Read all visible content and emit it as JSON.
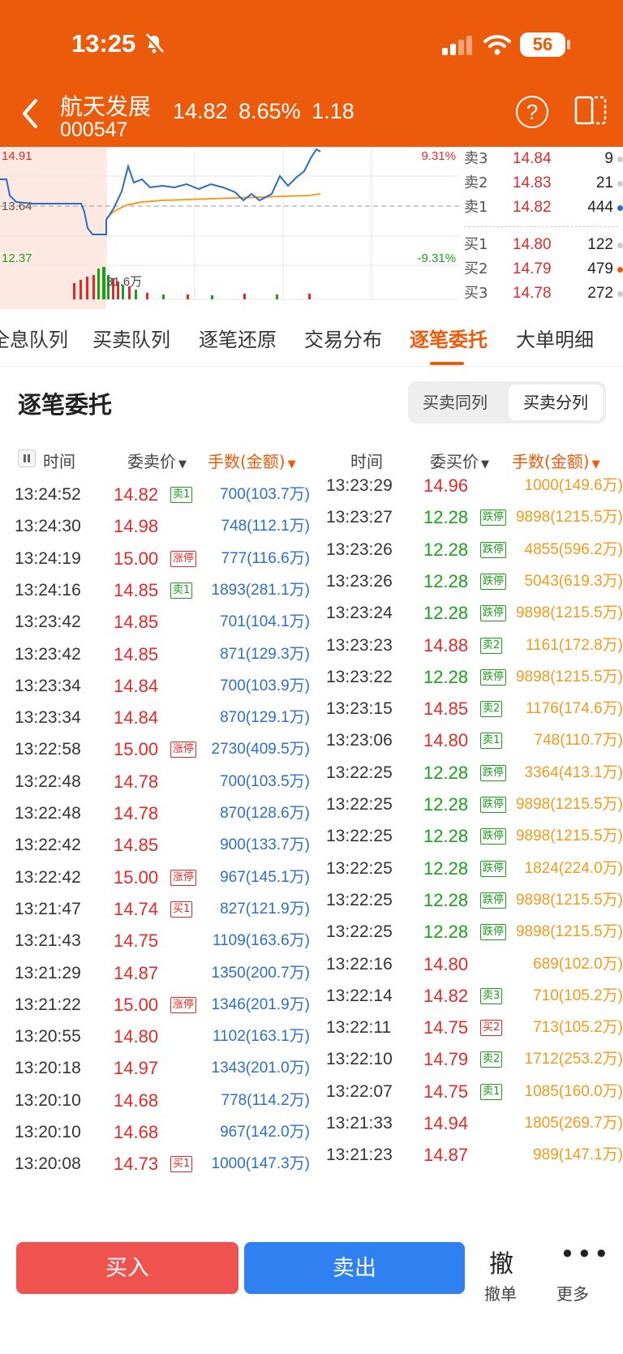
{
  "status_bar": {
    "time": "13:25",
    "battery": "56"
  },
  "header": {
    "name": "航天发展",
    "code": "000547",
    "price": "14.82",
    "change_pct": "8.65%",
    "change": "1.18"
  },
  "chart": {
    "price_high": "14.91",
    "price_pre": "13.64",
    "price_low": "12.37",
    "pct_high": "9.31%",
    "pct_low": "-9.31%",
    "volume_label": "31.6万"
  },
  "orderbook": {
    "asks": [
      {
        "label": "卖3",
        "price": "14.84",
        "volume": "9"
      },
      {
        "label": "卖2",
        "price": "14.83",
        "volume": "21"
      },
      {
        "label": "卖1",
        "price": "14.82",
        "volume": "444"
      }
    ],
    "bids": [
      {
        "label": "买1",
        "price": "14.80",
        "volume": "122"
      },
      {
        "label": "买2",
        "price": "14.79",
        "volume": "479"
      },
      {
        "label": "买3",
        "price": "14.78",
        "volume": "272"
      }
    ]
  },
  "tabs": [
    "全息队列",
    "买卖队列",
    "逐笔还原",
    "交易分布",
    "逐笔委托",
    "大单明细"
  ],
  "section": {
    "title": "逐笔委托",
    "seg_same": "买卖同列",
    "seg_split": "买卖分列"
  },
  "columns": {
    "sell_time": "时间",
    "sell_price": "委卖价",
    "sell_amount": "手数(金额)",
    "buy_time": "时间",
    "buy_price": "委买价",
    "buy_amount": "手数(金额)"
  },
  "sell_orders": [
    {
      "time": "13:24:52",
      "price": "14.82",
      "tag": "卖1",
      "amount": "700(103.7万)"
    },
    {
      "time": "13:24:30",
      "price": "14.98",
      "tag": "",
      "amount": "748(112.1万)"
    },
    {
      "time": "13:24:19",
      "price": "15.00",
      "tag": "涨停",
      "amount": "777(116.6万)"
    },
    {
      "time": "13:24:16",
      "price": "14.85",
      "tag": "卖1",
      "amount": "1893(281.1万)"
    },
    {
      "time": "13:23:42",
      "price": "14.85",
      "tag": "",
      "amount": "701(104.1万)"
    },
    {
      "time": "13:23:42",
      "price": "14.85",
      "tag": "",
      "amount": "871(129.3万)"
    },
    {
      "time": "13:23:34",
      "price": "14.84",
      "tag": "",
      "amount": "700(103.9万)"
    },
    {
      "time": "13:23:34",
      "price": "14.84",
      "tag": "",
      "amount": "870(129.1万)"
    },
    {
      "time": "13:22:58",
      "price": "15.00",
      "tag": "涨停",
      "amount": "2730(409.5万)"
    },
    {
      "time": "13:22:48",
      "price": "14.78",
      "tag": "",
      "amount": "700(103.5万)"
    },
    {
      "time": "13:22:48",
      "price": "14.78",
      "tag": "",
      "amount": "870(128.6万)"
    },
    {
      "time": "13:22:42",
      "price": "14.85",
      "tag": "",
      "amount": "900(133.7万)"
    },
    {
      "time": "13:22:42",
      "price": "15.00",
      "tag": "涨停",
      "amount": "967(145.1万)"
    },
    {
      "time": "13:21:47",
      "price": "14.74",
      "tag": "买1",
      "amount": "827(121.9万)"
    },
    {
      "time": "13:21:43",
      "price": "14.75",
      "tag": "",
      "amount": "1109(163.6万)"
    },
    {
      "time": "13:21:29",
      "price": "14.87",
      "tag": "",
      "amount": "1350(200.7万)"
    },
    {
      "time": "13:21:22",
      "price": "15.00",
      "tag": "涨停",
      "amount": "1346(201.9万)"
    },
    {
      "time": "13:20:55",
      "price": "14.80",
      "tag": "",
      "amount": "1102(163.1万)"
    },
    {
      "time": "13:20:18",
      "price": "14.97",
      "tag": "",
      "amount": "1343(201.0万)"
    },
    {
      "time": "13:20:10",
      "price": "14.68",
      "tag": "",
      "amount": "778(114.2万)"
    },
    {
      "time": "13:20:10",
      "price": "14.68",
      "tag": "",
      "amount": "967(142.0万)"
    },
    {
      "time": "13:20:08",
      "price": "14.73",
      "tag": "买1",
      "amount": "1000(147.3万)"
    }
  ],
  "buy_orders": [
    {
      "time": "13:23:29",
      "price": "14.96",
      "tag": "",
      "amount": "1000(149.6万)"
    },
    {
      "time": "13:23:27",
      "price": "12.28",
      "tag": "跌停",
      "amount": "9898(1215.5万)"
    },
    {
      "time": "13:23:26",
      "price": "12.28",
      "tag": "跌停",
      "amount": "4855(596.2万)"
    },
    {
      "time": "13:23:26",
      "price": "12.28",
      "tag": "跌停",
      "amount": "5043(619.3万)"
    },
    {
      "time": "13:23:24",
      "price": "12.28",
      "tag": "跌停",
      "amount": "9898(1215.5万)"
    },
    {
      "time": "13:23:23",
      "price": "14.88",
      "tag": "卖2",
      "amount": "1161(172.8万)"
    },
    {
      "time": "13:23:22",
      "price": "12.28",
      "tag": "跌停",
      "amount": "9898(1215.5万)"
    },
    {
      "time": "13:23:15",
      "price": "14.85",
      "tag": "卖2",
      "amount": "1176(174.6万)"
    },
    {
      "time": "13:23:06",
      "price": "14.80",
      "tag": "卖1",
      "amount": "748(110.7万)"
    },
    {
      "time": "13:22:25",
      "price": "12.28",
      "tag": "跌停",
      "amount": "3364(413.1万)"
    },
    {
      "time": "13:22:25",
      "price": "12.28",
      "tag": "跌停",
      "amount": "9898(1215.5万)"
    },
    {
      "time": "13:22:25",
      "price": "12.28",
      "tag": "跌停",
      "amount": "9898(1215.5万)"
    },
    {
      "time": "13:22:25",
      "price": "12.28",
      "tag": "跌停",
      "amount": "1824(224.0万)"
    },
    {
      "time": "13:22:25",
      "price": "12.28",
      "tag": "跌停",
      "amount": "9898(1215.5万)"
    },
    {
      "time": "13:22:25",
      "price": "12.28",
      "tag": "跌停",
      "amount": "9898(1215.5万)"
    },
    {
      "time": "13:22:16",
      "price": "14.80",
      "tag": "",
      "amount": "689(102.0万)"
    },
    {
      "time": "13:22:14",
      "price": "14.82",
      "tag": "卖3",
      "amount": "710(105.2万)"
    },
    {
      "time": "13:22:11",
      "price": "14.75",
      "tag": "买2",
      "amount": "713(105.2万)"
    },
    {
      "time": "13:22:10",
      "price": "14.79",
      "tag": "卖2",
      "amount": "1712(253.2万)"
    },
    {
      "time": "13:22:07",
      "price": "14.75",
      "tag": "卖1",
      "amount": "1085(160.0万)"
    },
    {
      "time": "13:21:33",
      "price": "14.94",
      "tag": "",
      "amount": "1805(269.7万)"
    },
    {
      "time": "13:21:23",
      "price": "14.87",
      "tag": "",
      "amount": "989(147.1万)"
    }
  ],
  "bottom_bar": {
    "buy": "买入",
    "sell": "卖出",
    "cancel_glyph": "撤",
    "cancel": "撤单",
    "more": "更多"
  },
  "colors": {
    "accent": "#ec5a0b",
    "up": "#e02a2a",
    "down": "#1aa01a",
    "sell_amount": "#2f6fc1",
    "buy_amount": "#f39a1a"
  }
}
